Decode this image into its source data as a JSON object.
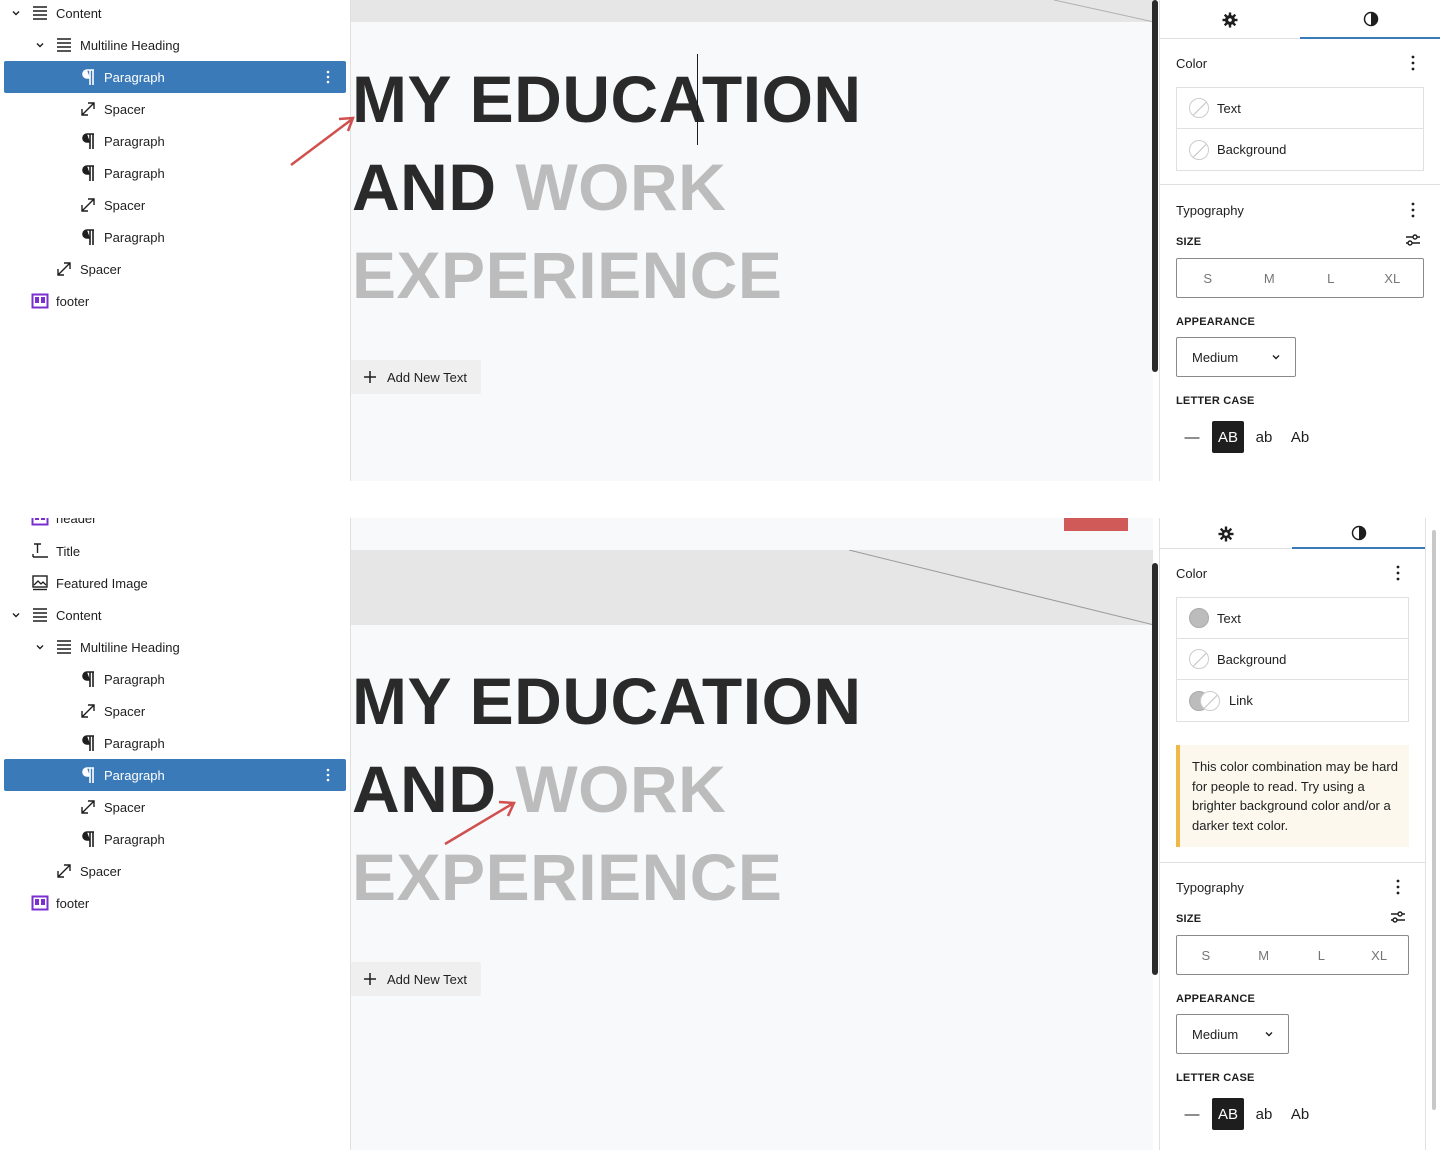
{
  "top": {
    "list": [
      {
        "label": "Content",
        "icon": "group-list-icon",
        "chevron": true
      },
      {
        "label": "Multiline Heading",
        "icon": "group-list-icon",
        "chevron": true
      },
      {
        "label": "Paragraph",
        "icon": "paragraph-icon",
        "selected": true
      },
      {
        "label": "Spacer",
        "icon": "spacer-icon"
      },
      {
        "label": "Paragraph",
        "icon": "paragraph-icon"
      },
      {
        "label": "Paragraph",
        "icon": "paragraph-icon"
      },
      {
        "label": "Spacer",
        "icon": "spacer-icon"
      },
      {
        "label": "Paragraph",
        "icon": "paragraph-icon"
      },
      {
        "label": "Spacer",
        "icon": "spacer-icon"
      },
      {
        "label": "footer",
        "icon": "template-part-icon"
      }
    ],
    "heading": {
      "line1": "MY EDUCATION",
      "line2_dark": "AND ",
      "line2_gray": "WORK",
      "line3": "EXPERIENCE"
    },
    "add_new_text": "Add New Text",
    "sidebar": {
      "color_title": "Color",
      "color_rows": [
        {
          "label": "Text",
          "swatch": "empty"
        },
        {
          "label": "Background",
          "swatch": "empty"
        }
      ],
      "typography_title": "Typography",
      "size_label": "SIZE",
      "sizes": [
        "S",
        "M",
        "L",
        "XL"
      ],
      "appearance_label": "APPEARANCE",
      "appearance_value": "Medium",
      "letter_case_label": "LETTER CASE",
      "letter_case": [
        "—",
        "AB",
        "ab",
        "Ab"
      ]
    }
  },
  "bottom": {
    "list": [
      {
        "label": "header",
        "icon": "template-part-icon"
      },
      {
        "label": "Title",
        "icon": "title-icon"
      },
      {
        "label": "Featured Image",
        "icon": "featured-image-icon"
      },
      {
        "label": "Content",
        "icon": "group-list-icon",
        "chevron": true
      },
      {
        "label": "Multiline Heading",
        "icon": "group-list-icon",
        "chevron": true
      },
      {
        "label": "Paragraph",
        "icon": "paragraph-icon"
      },
      {
        "label": "Spacer",
        "icon": "spacer-icon"
      },
      {
        "label": "Paragraph",
        "icon": "paragraph-icon"
      },
      {
        "label": "Paragraph",
        "icon": "paragraph-icon",
        "selected": true
      },
      {
        "label": "Spacer",
        "icon": "spacer-icon"
      },
      {
        "label": "Paragraph",
        "icon": "paragraph-icon"
      },
      {
        "label": "Spacer",
        "icon": "spacer-icon"
      },
      {
        "label": "footer",
        "icon": "template-part-icon"
      }
    ],
    "heading": {
      "line1": "MY EDUCATION",
      "line2_dark": "AND ",
      "line2_gray": "WORK",
      "line3": "EXPERIENCE"
    },
    "add_new_text": "Add New Text",
    "sidebar": {
      "color_title": "Color",
      "color_rows": [
        {
          "label": "Text",
          "swatch": "filled"
        },
        {
          "label": "Background",
          "swatch": "empty"
        },
        {
          "label": "Link",
          "swatch": "toggle"
        }
      ],
      "notice": "This color combination may be hard for people to read. Try using a brighter background color and/or a darker text color.",
      "typography_title": "Typography",
      "size_label": "SIZE",
      "sizes": [
        "S",
        "M",
        "L",
        "XL"
      ],
      "appearance_label": "APPEARANCE",
      "appearance_value": "Medium",
      "letter_case_label": "LETTER CASE",
      "letter_case": [
        "—",
        "AB",
        "ab",
        "Ab"
      ]
    }
  },
  "colors": {
    "selected_row": "#3a7ab8",
    "heading_dark": "#2a2a2a",
    "heading_gray": "#bcbcbc",
    "annotation_arrow": "#d0504f",
    "notice_border": "#f0b849"
  }
}
